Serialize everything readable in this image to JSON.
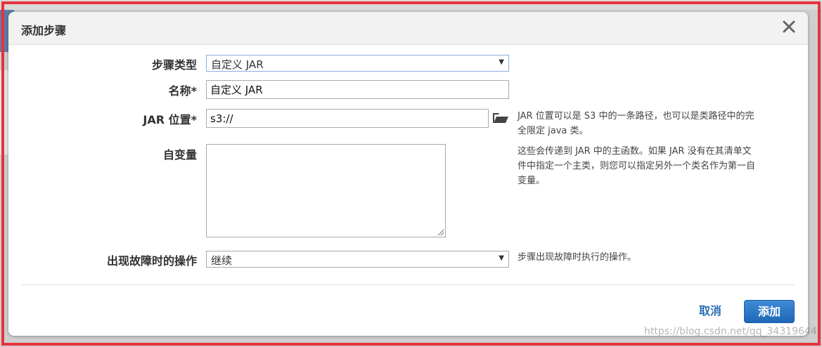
{
  "dialog": {
    "title": "添加步骤",
    "fields": {
      "step_type": {
        "label": "步骤类型",
        "value": "自定义 JAR"
      },
      "name": {
        "label": "名称*",
        "value": "自定义 JAR"
      },
      "jar_location": {
        "label": "JAR 位置*",
        "value": "s3://",
        "help_line1": "JAR 位置可以是 S3 中的一条路径，也可以是类路径中的完",
        "help_line2": "全限定 java 类。"
      },
      "arguments": {
        "label": "自变量",
        "value": "",
        "help_line1": "这些会传递到 JAR 中的主函数。如果 JAR 没有在其清单文",
        "help_line2": "件中指定一个主类，则您可以指定另外一个类名作为第一自",
        "help_line3": "变量。"
      },
      "action_on_failure": {
        "label": "出现故障时的操作",
        "value": "继续",
        "help": "步骤出现故障时执行的操作。"
      }
    },
    "buttons": {
      "cancel": "取消",
      "add": "添加"
    }
  },
  "watermark": "https://blog.csdn.net/qq_34319644"
}
